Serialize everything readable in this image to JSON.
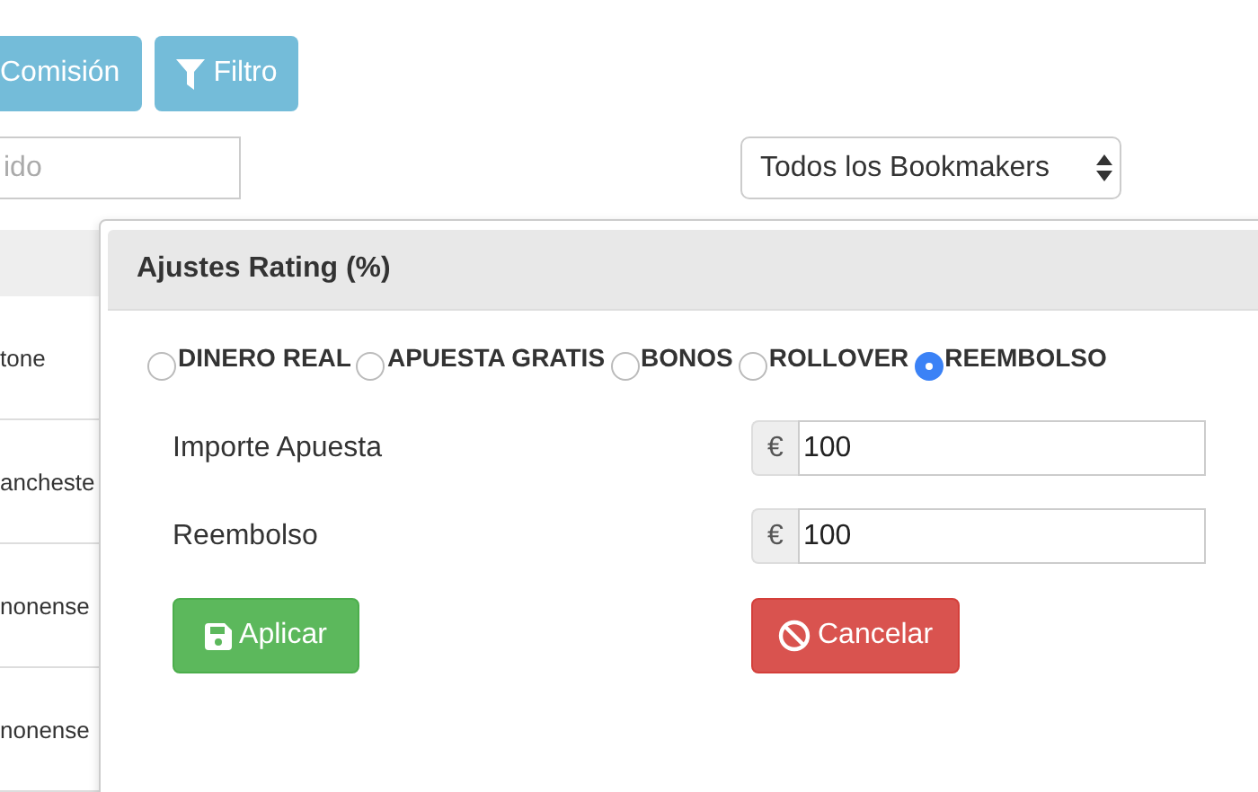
{
  "toolbar": {
    "buttons": [
      {
        "label": "Comisión",
        "kind": "plain"
      },
      {
        "label": "Filtro",
        "kind": "filter"
      }
    ]
  },
  "search": {
    "placeholder": "ido"
  },
  "bookmaker_select": {
    "value": "Todos los Bookmakers"
  },
  "table": {
    "rows": [
      {
        "cell": "tone"
      },
      {
        "cell": "ancheste"
      },
      {
        "cell": "nonense"
      },
      {
        "cell": "nonense"
      }
    ]
  },
  "popover": {
    "title": "Ajustes Rating (%)",
    "options": [
      {
        "label": "DINERO REAL",
        "selected": false
      },
      {
        "label": "APUESTA GRATIS",
        "selected": false
      },
      {
        "label": "BONOS",
        "selected": false
      },
      {
        "label": "ROLLOVER",
        "selected": false
      },
      {
        "label": "REEMBOLSO",
        "selected": true
      }
    ],
    "fields": [
      {
        "label": "Importe Apuesta",
        "prefix": "€",
        "value": "100"
      },
      {
        "label": "Reembolso",
        "prefix": "€",
        "value": "100"
      }
    ],
    "buttons": [
      {
        "label": "Aplicar",
        "kind": "apply"
      },
      {
        "label": "Cancelar",
        "kind": "cancel"
      }
    ]
  }
}
